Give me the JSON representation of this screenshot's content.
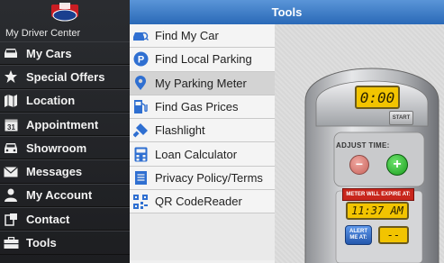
{
  "sidebar": {
    "center_label": "My Driver Center",
    "items": [
      {
        "label": "My Cars",
        "icon": "car-icon"
      },
      {
        "label": "Special Offers",
        "icon": "star-icon"
      },
      {
        "label": "Location",
        "icon": "map-icon"
      },
      {
        "label": "Appointment",
        "icon": "calendar-icon"
      },
      {
        "label": "Showroom",
        "icon": "car-front-icon"
      },
      {
        "label": "Messages",
        "icon": "envelope-icon"
      },
      {
        "label": "My Account",
        "icon": "person-icon"
      },
      {
        "label": "Contact",
        "icon": "phone-icon"
      },
      {
        "label": "Tools",
        "icon": "toolbox-icon"
      }
    ]
  },
  "header": {
    "title": "Tools"
  },
  "menu": {
    "items": [
      {
        "label": "Find My Car",
        "icon": "car-search-icon"
      },
      {
        "label": "Find Local Parking",
        "icon": "parking-icon"
      },
      {
        "label": "My Parking Meter",
        "icon": "map-pin-icon",
        "selected": true
      },
      {
        "label": "Find Gas Prices",
        "icon": "gas-pump-icon"
      },
      {
        "label": "Flashlight",
        "icon": "flashlight-icon"
      },
      {
        "label": "Loan Calculator",
        "icon": "calculator-icon"
      },
      {
        "label": "Privacy Policy/Terms",
        "icon": "document-icon"
      },
      {
        "label": "QR CodeReader",
        "icon": "qr-code-icon"
      }
    ]
  },
  "meter": {
    "time_display": "0:00",
    "start_label": "START",
    "adjust_label": "ADJUST TIME:",
    "minus": "−",
    "plus": "+",
    "expire_label": "METER WILL EXPIRE AT:",
    "expire_time": "11:37 AM",
    "alert_label": "ALERT ME AT:",
    "alert_value": "--"
  },
  "colors": {
    "header_blue": "#2a69b7",
    "lcd_yellow": "#f2c400",
    "plus_green": "#27b52a",
    "expire_red": "#c8261c",
    "alert_blue": "#2f6fd1"
  }
}
